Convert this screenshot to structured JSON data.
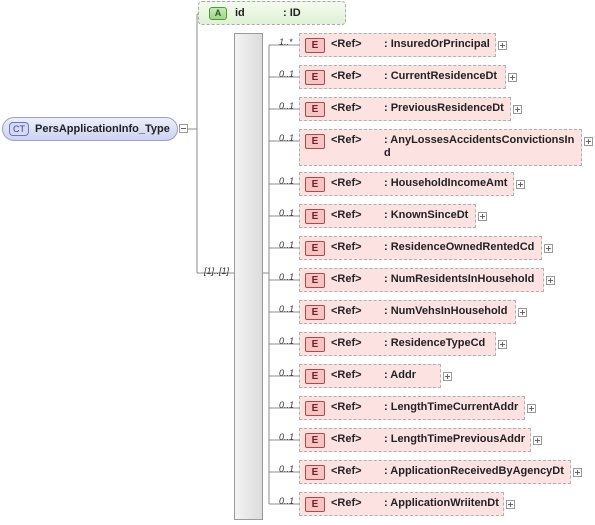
{
  "complex_type": {
    "tag": "CT",
    "name": "PersApplicationInfo_Type"
  },
  "attribute": {
    "tag": "A",
    "name": "id",
    "type": ": ID"
  },
  "sequence": {
    "occurs": "[1]..[1]"
  },
  "elements": [
    {
      "occurs": "1..*",
      "tag": "E",
      "ref": "<Ref>",
      "name": ": InsuredOrPrincipal"
    },
    {
      "occurs": "0..1",
      "tag": "E",
      "ref": "<Ref>",
      "name": ": CurrentResidenceDt"
    },
    {
      "occurs": "0..1",
      "tag": "E",
      "ref": "<Ref>",
      "name": ": PreviousResidenceDt"
    },
    {
      "occurs": "0..1",
      "tag": "E",
      "ref": "<Ref>",
      "name": ": AnyLossesAccidentsConvictionsInd"
    },
    {
      "occurs": "0..1",
      "tag": "E",
      "ref": "<Ref>",
      "name": ": HouseholdIncomeAmt"
    },
    {
      "occurs": "0..1",
      "tag": "E",
      "ref": "<Ref>",
      "name": ": KnownSinceDt"
    },
    {
      "occurs": "0..1",
      "tag": "E",
      "ref": "<Ref>",
      "name": ": ResidenceOwnedRentedCd"
    },
    {
      "occurs": "0..1",
      "tag": "E",
      "ref": "<Ref>",
      "name": ": NumResidentsInHousehold"
    },
    {
      "occurs": "0..1",
      "tag": "E",
      "ref": "<Ref>",
      "name": ": NumVehsInHousehold"
    },
    {
      "occurs": "0..1",
      "tag": "E",
      "ref": "<Ref>",
      "name": ": ResidenceTypeCd"
    },
    {
      "occurs": "0..1",
      "tag": "E",
      "ref": "<Ref>",
      "name": ": Addr"
    },
    {
      "occurs": "0..1",
      "tag": "E",
      "ref": "<Ref>",
      "name": ": LengthTimeCurrentAddr"
    },
    {
      "occurs": "0..1",
      "tag": "E",
      "ref": "<Ref>",
      "name": ": LengthTimePreviousAddr"
    },
    {
      "occurs": "0..1",
      "tag": "E",
      "ref": "<Ref>",
      "name": ": ApplicationReceivedByAgencyDt"
    },
    {
      "occurs": "0..1",
      "tag": "E",
      "ref": "<Ref>",
      "name": ": ApplicationWriitenDt"
    }
  ]
}
